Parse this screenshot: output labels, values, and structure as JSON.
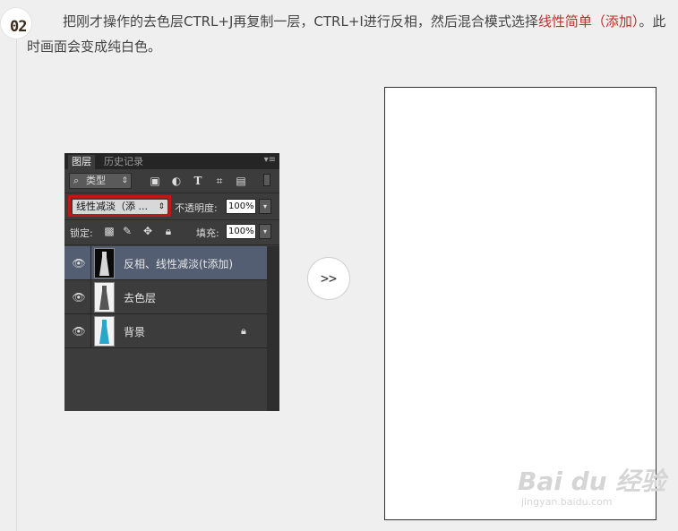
{
  "step": {
    "number": "02"
  },
  "instruction": {
    "text_before": "把刚才操作的去色层CTRL+J再复制一层，CTRL+I进行反相，然后混合模式选择",
    "highlight": "线性简单（添加）",
    "text_after": "。此时画面会变成纯白色。",
    "highlight_color": "#b8322d"
  },
  "panel": {
    "tabs": [
      "图层",
      "历史记录"
    ],
    "filter": {
      "kind_label": "类型"
    },
    "blend_mode": "线性减淡（添 ...",
    "opacity_label": "不透明度:",
    "opacity_value": "100%",
    "lock_label": "锁定:",
    "fill_label": "填充:",
    "fill_value": "100%",
    "layers": [
      {
        "name": "反相、线性减淡(t添加)",
        "selected": true,
        "locked": false,
        "icon": "eye-icon"
      },
      {
        "name": "去色层",
        "selected": false,
        "locked": false,
        "icon": "eye-icon"
      },
      {
        "name": "背景",
        "selected": false,
        "locked": true,
        "icon": "eye-icon"
      }
    ]
  },
  "arrow": {
    "label": ">>"
  },
  "watermark": {
    "main": "Bai du 经验",
    "sub": "jingyan.baidu.com"
  },
  "colors": {
    "panel_bg": "#3c3c3c",
    "selected_layer": "#535e73",
    "highlight_box": "#c01818"
  }
}
